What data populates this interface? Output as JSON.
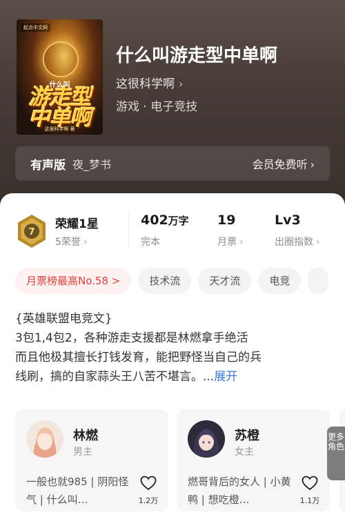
{
  "book": {
    "title": "什么叫游走型中单啊",
    "author": "这很科学啊",
    "category": "游戏 · 电子竞技",
    "cover": {
      "publisher": "起点中文网",
      "line1": "什么叫",
      "line2": "游走型\n中单啊",
      "line3": "这很科学啊 著"
    }
  },
  "audio": {
    "label": "有声版",
    "narrator": "夜_梦书",
    "free_label": "会员免费听"
  },
  "stats": {
    "honor_level": "荣耀1星",
    "honor_count": "5荣誉",
    "badge_number": "7",
    "words_value": "402",
    "words_unit": "万字",
    "words_status": "完本",
    "tickets_value": "19",
    "tickets_label": "月票",
    "level_value": "Lv3",
    "level_label": "出圈指数"
  },
  "tags": [
    "月票榜最高No.58 >",
    "技术流",
    "天才流",
    "电竞"
  ],
  "description": {
    "line1": "{英雄联盟电竞文}",
    "line2": "3包1,4包2，各种游走支援都是林燃拿手绝活",
    "line3": "而且他极其擅长打钱发育，能把野怪当自己的兵",
    "line4": "线刷，搞的自家蒜头王八苦不堪言。...",
    "expand": "展开"
  },
  "characters": [
    {
      "name": "林燃",
      "role": "男主",
      "desc": "一般也就985 | 阴阳怪气 | 什么叫…",
      "likes": "1.2万"
    },
    {
      "name": "苏橙",
      "role": "女主",
      "desc": "燃哥背后的女人 | 小黄鸭 | 想吃橙…",
      "likes": "1.1万"
    }
  ],
  "more_characters": "更多角色",
  "colors": {
    "accent_red": "#d9443f",
    "link_blue": "#3a78d6",
    "hero_bg": "#463b36"
  }
}
